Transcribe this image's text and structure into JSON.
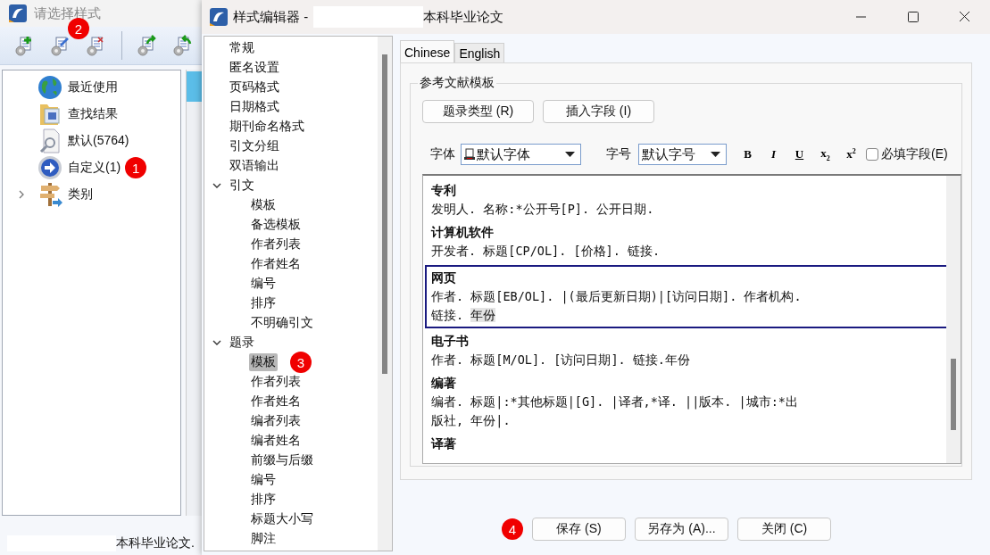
{
  "back_window": {
    "title": "请选择样式",
    "toolbar": {
      "marker": "2"
    },
    "tree": [
      {
        "label": "最近使用",
        "kind": "globe"
      },
      {
        "label": "查找结果",
        "kind": "folder"
      },
      {
        "label": "默认(5764)",
        "kind": "search"
      },
      {
        "label": "自定义(1)",
        "kind": "arrow",
        "marker": "1"
      },
      {
        "label": "类别",
        "kind": "signpost",
        "expanded": false
      }
    ],
    "status_text": "本科毕业论文."
  },
  "editor_window": {
    "title": "样式编辑器 -",
    "title_suffix": "本科毕业论文",
    "nav_tree": [
      {
        "label": "常规",
        "selected": false
      },
      {
        "label": "匿名设置",
        "selected": false
      },
      {
        "label": "页码格式",
        "selected": false
      },
      {
        "label": "日期格式",
        "selected": false
      },
      {
        "label": "期刊命名格式",
        "selected": false
      },
      {
        "label": "引文分组",
        "selected": false
      },
      {
        "label": "双语输出",
        "selected": false
      },
      {
        "label": "引文",
        "selected": false,
        "expanded": true,
        "children": [
          {
            "label": "模板",
            "selected": false
          },
          {
            "label": "备选模板",
            "selected": false
          },
          {
            "label": "作者列表",
            "selected": false
          },
          {
            "label": "作者姓名",
            "selected": false
          },
          {
            "label": "编号",
            "selected": false
          },
          {
            "label": "排序",
            "selected": false
          },
          {
            "label": "不明确引文",
            "selected": false
          }
        ]
      },
      {
        "label": "题录",
        "selected": false,
        "expanded": true,
        "children": [
          {
            "label": "模板",
            "selected": true,
            "marker": "3"
          },
          {
            "label": "作者列表",
            "selected": false
          },
          {
            "label": "作者姓名",
            "selected": false
          },
          {
            "label": "编者列表",
            "selected": false
          },
          {
            "label": "编者姓名",
            "selected": false
          },
          {
            "label": "前缀与后缀",
            "selected": false
          },
          {
            "label": "编号",
            "selected": false
          },
          {
            "label": "排序",
            "selected": false
          },
          {
            "label": "标题大小写",
            "selected": false
          },
          {
            "label": "脚注",
            "selected": false
          }
        ]
      }
    ],
    "tabs": [
      {
        "label": "Chinese",
        "selected": true
      },
      {
        "label": "English",
        "selected": false
      }
    ],
    "group_title": "参考文献模板",
    "buttons": [
      "题录类型 (R)",
      "插入字段 (I)"
    ],
    "font_label": "字体",
    "font_value": "默认字体",
    "size_label": "字号",
    "size_value": "默认字号",
    "format_buttons": [
      "B",
      "I",
      "U",
      "x$_{2}$",
      "x$^{2}$"
    ],
    "required_checkbox": {
      "label": "必填字段(E)",
      "checked": false
    },
    "entries": [
      {
        "title": "专利",
        "lines": [
          "发明人. 名称:*公开号[P]. 公开日期."
        ],
        "selected": false
      },
      {
        "title": "计算机软件",
        "lines": [
          "开发者. 标题[CP/OL]. [价格]. 链接."
        ],
        "selected": false
      },
      {
        "title": "网页",
        "lines": [
          "作者. 标题[EB/OL]. |(最后更新日期)|[访问日期]. 作者机构.",
          "链接. "
        ],
        "highlight": "年份",
        "selected": true
      },
      {
        "title": "电子书",
        "lines": [
          "作者. 标题[M/OL]. [访问日期]. 链接.年份"
        ],
        "selected": false
      },
      {
        "title": "编著",
        "lines": [
          "编者. 标题|:*其他标题|[G]. |译者,*译. ||版本. |城市:*出",
          "版社, 年份|."
        ],
        "selected": false
      },
      {
        "title": "译著",
        "selected": false
      }
    ],
    "footer_marker": "4",
    "footer_buttons": [
      "保存 (S)",
      "另存为 (A)...",
      "关闭 (C)"
    ]
  }
}
